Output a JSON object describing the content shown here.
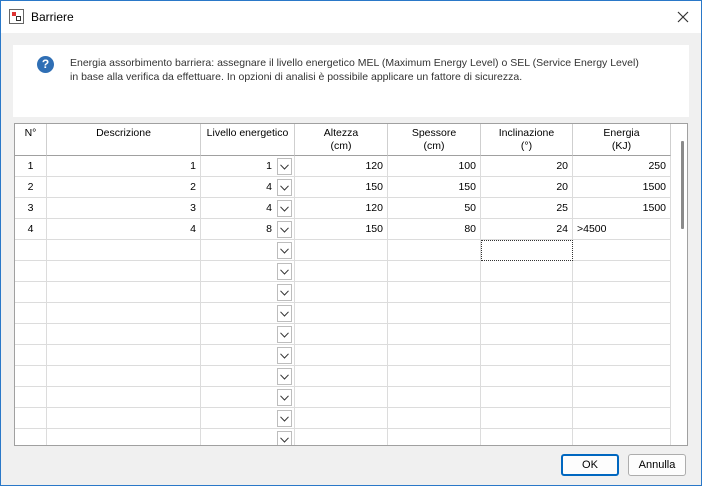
{
  "window": {
    "title": "Barriere",
    "icon": "app-icon",
    "close_icon": "close-icon"
  },
  "info": {
    "icon": "question-icon",
    "icon_glyph": "?",
    "line1": "Energia assorbimento barriera: assegnare il livello energetico MEL (Maximum Energy Level) o SEL (Service Energy Level)",
    "line2": "in base alla verifica da effettuare. In opzioni di analisi è possibile applicare un fattore di sicurezza."
  },
  "table": {
    "columns": [
      {
        "key": "n",
        "line1": "N°",
        "line2": ""
      },
      {
        "key": "descrizione",
        "line1": "Descrizione",
        "line2": ""
      },
      {
        "key": "livello",
        "line1": "Livello energetico",
        "line2": ""
      },
      {
        "key": "altezza",
        "line1": "Altezza",
        "line2": "(cm)"
      },
      {
        "key": "spessore",
        "line1": "Spessore",
        "line2": "(cm)"
      },
      {
        "key": "inclinazione",
        "line1": "Inclinazione",
        "line2": "(°)"
      },
      {
        "key": "energia",
        "line1": "Energia",
        "line2": "(KJ)"
      }
    ],
    "rows": [
      {
        "n": "1",
        "descrizione": "1",
        "livello": "1",
        "altezza": "120",
        "spessore": "100",
        "inclinazione": "20",
        "energia": "250"
      },
      {
        "n": "2",
        "descrizione": "2",
        "livello": "4",
        "altezza": "150",
        "spessore": "150",
        "inclinazione": "20",
        "energia": "1500"
      },
      {
        "n": "3",
        "descrizione": "3",
        "livello": "4",
        "altezza": "120",
        "spessore": "50",
        "inclinazione": "25",
        "energia": "1500"
      },
      {
        "n": "4",
        "descrizione": "4",
        "livello": "8",
        "altezza": "150",
        "spessore": "80",
        "inclinazione": "24",
        "energia": ">4500"
      },
      {
        "n": "",
        "descrizione": "",
        "livello": "",
        "altezza": "",
        "spessore": "",
        "inclinazione": "",
        "energia": ""
      },
      {
        "n": "",
        "descrizione": "",
        "livello": "",
        "altezza": "",
        "spessore": "",
        "inclinazione": "",
        "energia": ""
      },
      {
        "n": "",
        "descrizione": "",
        "livello": "",
        "altezza": "",
        "spessore": "",
        "inclinazione": "",
        "energia": ""
      },
      {
        "n": "",
        "descrizione": "",
        "livello": "",
        "altezza": "",
        "spessore": "",
        "inclinazione": "",
        "energia": ""
      },
      {
        "n": "",
        "descrizione": "",
        "livello": "",
        "altezza": "",
        "spessore": "",
        "inclinazione": "",
        "energia": ""
      },
      {
        "n": "",
        "descrizione": "",
        "livello": "",
        "altezza": "",
        "spessore": "",
        "inclinazione": "",
        "energia": ""
      },
      {
        "n": "",
        "descrizione": "",
        "livello": "",
        "altezza": "",
        "spessore": "",
        "inclinazione": "",
        "energia": ""
      },
      {
        "n": "",
        "descrizione": "",
        "livello": "",
        "altezza": "",
        "spessore": "",
        "inclinazione": "",
        "energia": ""
      },
      {
        "n": "",
        "descrizione": "",
        "livello": "",
        "altezza": "",
        "spessore": "",
        "inclinazione": "",
        "energia": ""
      },
      {
        "n": "",
        "descrizione": "",
        "livello": "",
        "altezza": "",
        "spessore": "",
        "inclinazione": "",
        "energia": ""
      }
    ],
    "dropdown_icon": "chevron-down-icon",
    "selected_cell": {
      "row": 4,
      "column": "inclinazione"
    }
  },
  "buttons": {
    "ok": "OK",
    "cancel": "Annulla"
  }
}
